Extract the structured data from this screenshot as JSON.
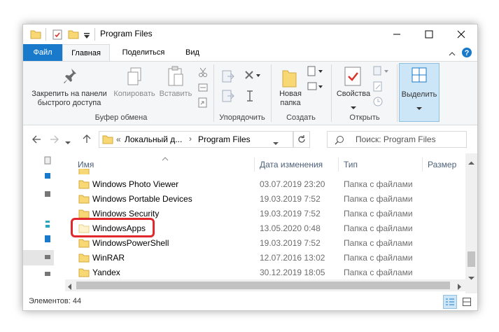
{
  "window": {
    "title": "Program Files",
    "controls": {
      "minimize": "—",
      "maximize": "☐",
      "close": "✕"
    }
  },
  "ribbon_tabs": [
    {
      "label": "Файл"
    },
    {
      "label": "Главная"
    },
    {
      "label": "Поделиться"
    },
    {
      "label": "Вид"
    }
  ],
  "ribbon": {
    "pin": "Закрепить на панели быстрого доступа",
    "pin_line1": "Закрепить на панели",
    "pin_line2": "быстрого доступа",
    "copy": "Копировать",
    "paste": "Вставить",
    "group_clipboard": "Буфер обмена",
    "group_organize": "Упорядочить",
    "new_folder_line1": "Новая",
    "new_folder_line2": "папка",
    "group_create": "Создать",
    "properties": "Свойства",
    "group_open": "Открыть",
    "select": "Выделить"
  },
  "address": {
    "prefix": "«",
    "crumb1": "Локальный д...",
    "sep": "›",
    "crumb2": "Program Files",
    "search_placeholder": "Поиск: Program Files"
  },
  "columns": {
    "name": "Имя",
    "date": "Дата изменения",
    "type": "Тип",
    "size": "Размер"
  },
  "files": [
    {
      "name": "Windows Photo Viewer",
      "date": "03.07.2019 23:20",
      "type": "Папка с файлами"
    },
    {
      "name": "Windows Portable Devices",
      "date": "19.03.2019 7:52",
      "type": "Папка с файлами"
    },
    {
      "name": "Windows Security",
      "date": "19.03.2019 7:52",
      "type": "Папка с файлами"
    },
    {
      "name": "WindowsApps",
      "date": "13.05.2020 0:48",
      "type": "Папка с файлами"
    },
    {
      "name": "WindowsPowerShell",
      "date": "19.03.2019 7:52",
      "type": "Папка с файлами"
    },
    {
      "name": "WinRAR",
      "date": "12.07.2016 13:02",
      "type": "Папка с файлами"
    },
    {
      "name": "Yandex",
      "date": "30.12.2019 18:05",
      "type": "Папка с файлами"
    }
  ],
  "status": {
    "items": "Элементов: 44"
  },
  "colors": {
    "file_tab": "#1979ca",
    "folder_yellow": "#f8d775",
    "highlight_red": "#e0282d"
  }
}
